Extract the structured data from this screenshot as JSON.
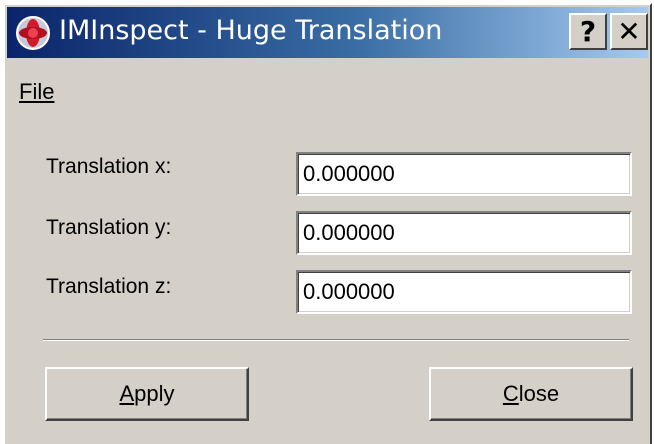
{
  "window": {
    "title": "IMInspect - Huge Translation",
    "help_label": "?",
    "close_label": "✕"
  },
  "menu": {
    "items": [
      {
        "label": "File"
      }
    ]
  },
  "fields": [
    {
      "label": "Translation x:",
      "value": "0.000000"
    },
    {
      "label": "Translation y:",
      "value": "0.000000"
    },
    {
      "label": "Translation z:",
      "value": "0.000000"
    }
  ],
  "buttons": {
    "apply": {
      "mnemonic": "A",
      "rest": "pply"
    },
    "close": {
      "mnemonic": "C",
      "rest": "lose"
    }
  },
  "colors": {
    "dialog_face": "#d4d0c8",
    "title_gradient_start": "#0a246a",
    "title_gradient_end": "#a6caf0"
  }
}
